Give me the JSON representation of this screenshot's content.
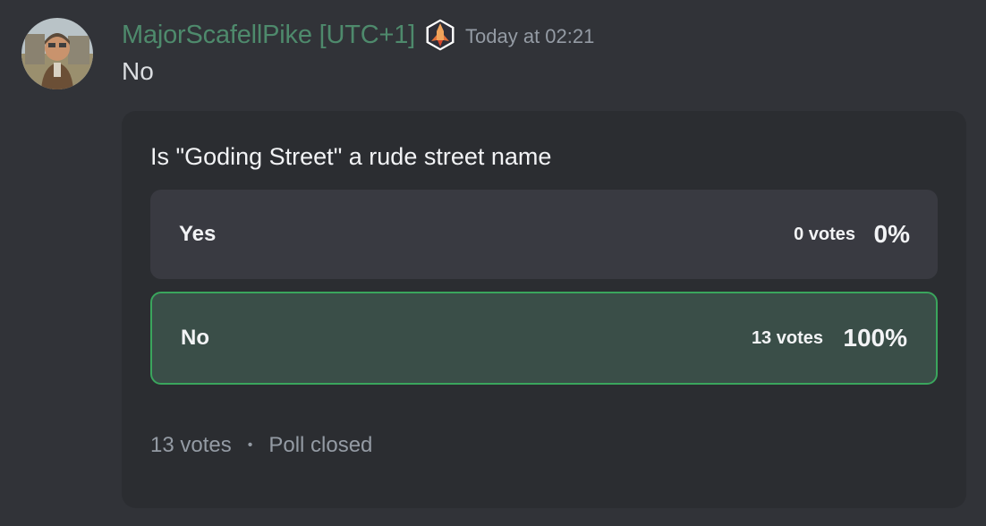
{
  "message": {
    "author": "MajorScafellPike [UTC+1]",
    "timestamp": "Today at 02:21",
    "content": "No",
    "author_color": "#4e8a6c",
    "role_icon": "rocket-role-icon"
  },
  "poll": {
    "question": "Is \"Goding Street\" a rude street name",
    "answers": [
      {
        "label": "Yes",
        "votes": "0 votes",
        "percent": "0%",
        "fraction": 0.0
      },
      {
        "label": "No",
        "votes": "13 votes",
        "percent": "100%",
        "fraction": 1.0,
        "selected": true
      }
    ],
    "total_votes": "13 votes",
    "separator": "•",
    "status": "Poll closed",
    "winner_color": "#3aa55d"
  }
}
